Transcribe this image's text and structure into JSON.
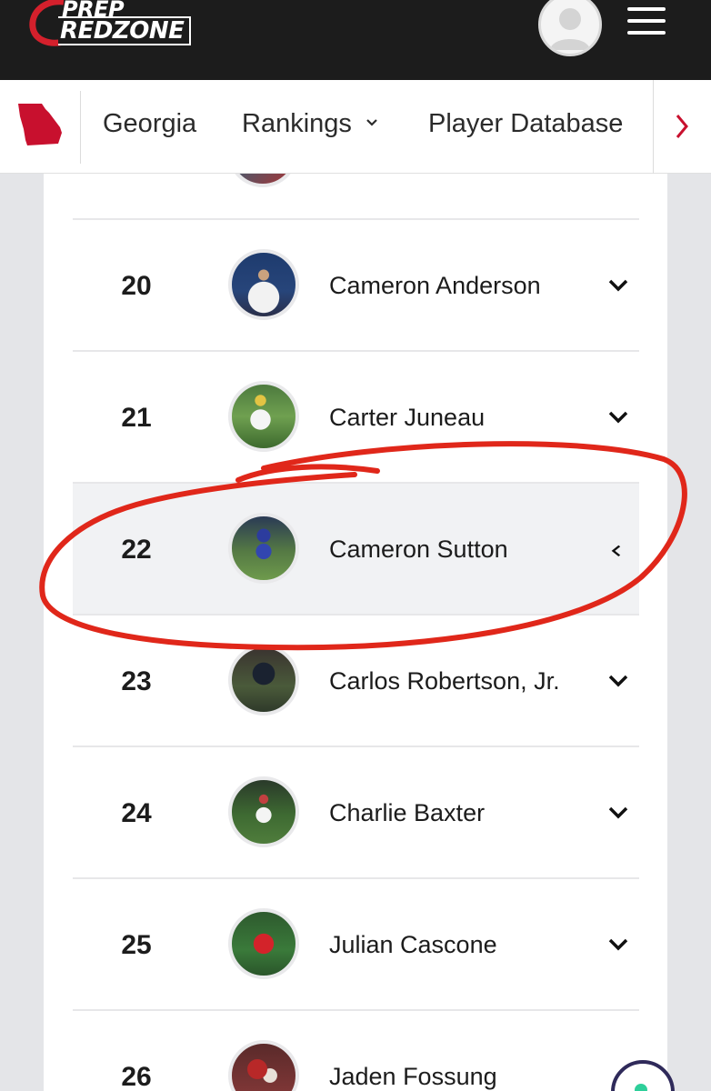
{
  "header": {
    "logo_line1": "PREP",
    "logo_line2": "REDZONE"
  },
  "nav": {
    "state_icon": "georgia-state-icon",
    "items": [
      {
        "label": "Georgia"
      },
      {
        "label": "Rankings"
      },
      {
        "label": "Player Database"
      }
    ]
  },
  "rankings": [
    {
      "rank": "20",
      "name": "Cameron Anderson",
      "expanded": false
    },
    {
      "rank": "21",
      "name": "Carter Juneau",
      "expanded": false
    },
    {
      "rank": "22",
      "name": "Cameron Sutton",
      "expanded": true
    },
    {
      "rank": "23",
      "name": "Carlos Robertson, Jr.",
      "expanded": false
    },
    {
      "rank": "24",
      "name": "Charlie Baxter",
      "expanded": false
    },
    {
      "rank": "25",
      "name": "Julian Cascone",
      "expanded": false
    },
    {
      "rank": "26",
      "name": "Jaden Fossung",
      "expanded": false
    }
  ],
  "colors": {
    "brand_red": "#c8102e",
    "header_bg": "#1c1c1c",
    "highlight_row": "#f1f2f4",
    "annotation_red": "#e0271a"
  }
}
